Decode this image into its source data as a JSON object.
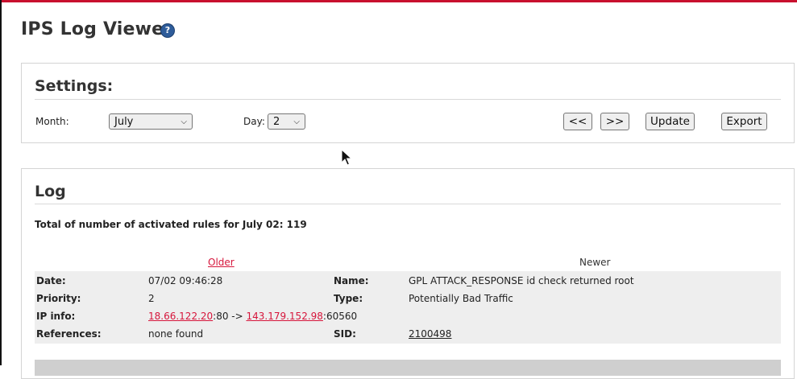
{
  "header": {
    "title": "IPS Log Viewer",
    "help_icon": "?"
  },
  "settings": {
    "title": "Settings:",
    "month_label": "Month:",
    "month_value": "July",
    "day_label": "Day:",
    "day_value": "2",
    "prev_label": "<<",
    "next_label": ">>",
    "update_label": "Update",
    "export_label": "Export"
  },
  "log": {
    "title": "Log",
    "total": "Total of number of activated rules for July 02: 119",
    "older": "Older",
    "newer": "Newer",
    "entry": {
      "date_label": "Date:",
      "date": "07/02 09:46:28",
      "priority_label": "Priority:",
      "priority": "2",
      "ipinfo_label": "IP info:",
      "src_ip": "18.66.122.20",
      "src_port": ":80 -> ",
      "dst_ip": "143.179.152.98",
      "dst_port": ":60560",
      "references_label": "References:",
      "references": "none found",
      "name_label": "Name:",
      "name": "GPL ATTACK_RESPONSE id check returned root",
      "type_label": "Type:",
      "type": "Potentially Bad Traffic",
      "sid_label": "SID:",
      "sid": "2100498"
    }
  },
  "colors": {
    "accent": "#d6153b",
    "help": "#2e5c9a",
    "entry_bg": "#eeeeee"
  }
}
